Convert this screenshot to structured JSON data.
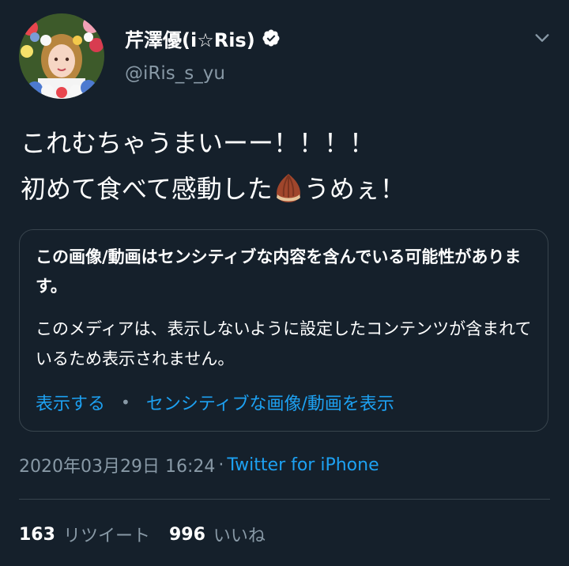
{
  "user": {
    "display_name": "芹澤優(i☆Ris)",
    "handle": "@iRis_s_yu",
    "verified": true
  },
  "tweet": {
    "line1": "これむちゃうまいーー！！！！",
    "line2_before": "初めて食べて感動した",
    "line2_emoji": "chestnut-emoji",
    "line2_after": "うめぇ！"
  },
  "sensitive_notice": {
    "title": "この画像/動画はセンシティブな内容を含んでいる可能性があります。",
    "body": "このメディアは、表示しないように設定したコンテンツが含まれているため表示されません。",
    "show_label": "表示する",
    "separator": "•",
    "show_all_label": "センシティブな画像/動画を表示"
  },
  "meta": {
    "timestamp": "2020年03月29日 16:24",
    "separator": "·",
    "source": "Twitter for iPhone"
  },
  "stats": {
    "retweets_count": "163",
    "retweets_label": "リツイート",
    "likes_count": "996",
    "likes_label": "いいね"
  },
  "colors": {
    "background": "#15202b",
    "text": "#ffffff",
    "secondary": "#8899a6",
    "link": "#1da1f2",
    "border": "#38444d"
  },
  "icons": {
    "verified": "verified-badge-icon",
    "caret": "chevron-down-icon"
  }
}
